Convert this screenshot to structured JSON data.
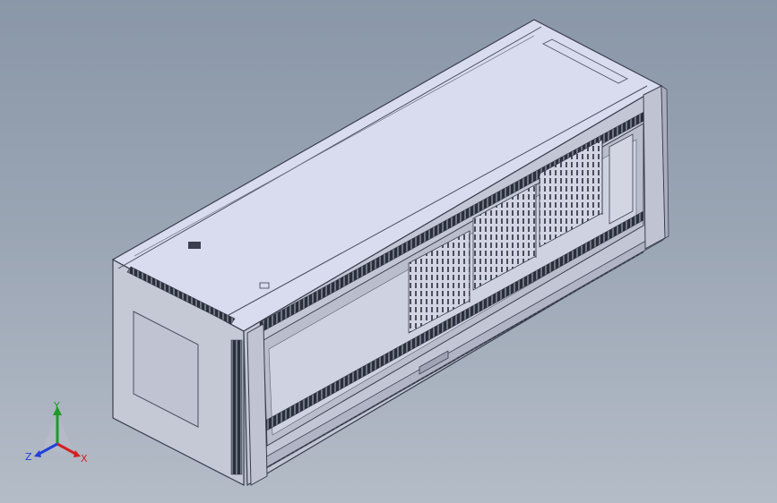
{
  "viewport": {
    "background_top": "#8a97a8",
    "background_bottom": "#b4bcc7"
  },
  "model": {
    "name": "",
    "body_color": "#c8ccdc",
    "top_color": "#dadcf0",
    "edge_color": "#3a3f4e",
    "vent_color": "#2b2f3a"
  },
  "triad": {
    "x_label": "X",
    "y_label": "Y",
    "z_label": "Z",
    "x_color": "#d42020",
    "y_color": "#1e9a2a",
    "z_color": "#2340d8"
  }
}
